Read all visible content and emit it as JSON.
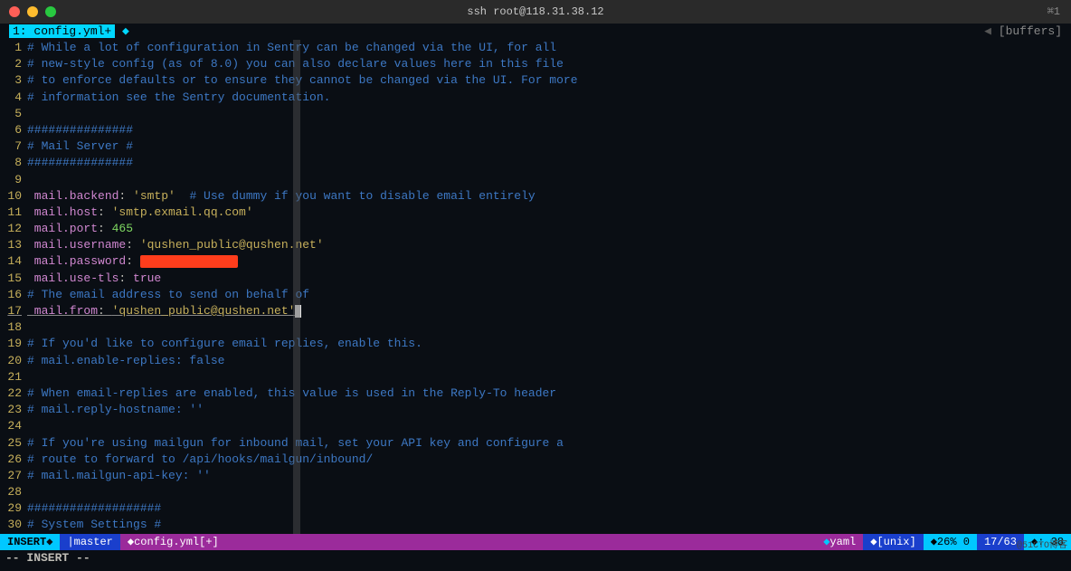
{
  "title": "ssh root@118.31.38.12",
  "title_keys": "⌘1",
  "buffer_tab": "1: config.yml+",
  "buffer_right": "[buffers]",
  "lines": [
    {
      "n": "1",
      "segs": [
        {
          "t": "# While a lot of configuration in Sentry can be changed via the UI, for all",
          "c": "comment"
        }
      ]
    },
    {
      "n": "2",
      "segs": [
        {
          "t": "# new-style config (as of 8.0) you can also declare values here in this file",
          "c": "comment"
        }
      ]
    },
    {
      "n": "3",
      "segs": [
        {
          "t": "# to enforce defaults or to ensure they cannot be changed via the UI. For more",
          "c": "comment"
        }
      ]
    },
    {
      "n": "4",
      "segs": [
        {
          "t": "# information see the Sentry documentation.",
          "c": "comment"
        }
      ]
    },
    {
      "n": "5",
      "segs": []
    },
    {
      "n": "6",
      "segs": [
        {
          "t": "###############",
          "c": "comment"
        }
      ]
    },
    {
      "n": "7",
      "segs": [
        {
          "t": "# Mail Server #",
          "c": "comment"
        }
      ]
    },
    {
      "n": "8",
      "segs": [
        {
          "t": "###############",
          "c": "comment"
        }
      ]
    },
    {
      "n": "9",
      "segs": []
    },
    {
      "n": "10",
      "segs": [
        {
          "t": " mail.backend",
          "c": "key"
        },
        {
          "t": ": ",
          "c": "colon"
        },
        {
          "t": "'smtp'",
          "c": "string"
        },
        {
          "t": "  # Use dummy if you want to disable email entirely",
          "c": "comment"
        }
      ]
    },
    {
      "n": "11",
      "segs": [
        {
          "t": " mail.host",
          "c": "key"
        },
        {
          "t": ": ",
          "c": "colon"
        },
        {
          "t": "'smtp.exmail.qq.com'",
          "c": "string"
        }
      ]
    },
    {
      "n": "12",
      "segs": [
        {
          "t": " mail.port",
          "c": "key"
        },
        {
          "t": ": ",
          "c": "colon"
        },
        {
          "t": "465",
          "c": "value"
        }
      ]
    },
    {
      "n": "13",
      "segs": [
        {
          "t": " mail.username",
          "c": "key"
        },
        {
          "t": ": ",
          "c": "colon"
        },
        {
          "t": "'qushen_public@qushen.net'",
          "c": "string"
        }
      ]
    },
    {
      "n": "14",
      "segs": [
        {
          "t": " mail.password",
          "c": "key"
        },
        {
          "t": ": ",
          "c": "colon"
        },
        {
          "t": "",
          "c": "redact"
        }
      ]
    },
    {
      "n": "15",
      "segs": [
        {
          "t": " mail.use-tls",
          "c": "key"
        },
        {
          "t": ": ",
          "c": "colon"
        },
        {
          "t": "true",
          "c": "bool"
        }
      ]
    },
    {
      "n": "16",
      "segs": [
        {
          "t": "# The email address to send on behalf of",
          "c": "comment"
        }
      ]
    },
    {
      "n": "17",
      "active": true,
      "segs": [
        {
          "t": " mail.from",
          "c": "key"
        },
        {
          "t": ": ",
          "c": "colon"
        },
        {
          "t": "'qushen_public@qushen.net'",
          "c": "string"
        },
        {
          "t": "",
          "c": "cursor"
        }
      ]
    },
    {
      "n": "18",
      "segs": []
    },
    {
      "n": "19",
      "segs": [
        {
          "t": "# If you'd like to configure email replies, enable this.",
          "c": "comment"
        }
      ]
    },
    {
      "n": "20",
      "segs": [
        {
          "t": "# mail.enable-replies: false",
          "c": "comment"
        }
      ]
    },
    {
      "n": "21",
      "segs": []
    },
    {
      "n": "22",
      "segs": [
        {
          "t": "# When email-replies are enabled, this value is used in the Reply-To header",
          "c": "comment"
        }
      ]
    },
    {
      "n": "23",
      "segs": [
        {
          "t": "# mail.reply-hostname: ''",
          "c": "comment"
        }
      ]
    },
    {
      "n": "24",
      "segs": []
    },
    {
      "n": "25",
      "segs": [
        {
          "t": "# If you're using mailgun for inbound mail, set your API key and configure a",
          "c": "comment"
        }
      ]
    },
    {
      "n": "26",
      "segs": [
        {
          "t": "# route to forward to /api/hooks/mailgun/inbound/",
          "c": "comment"
        }
      ]
    },
    {
      "n": "27",
      "segs": [
        {
          "t": "# mail.mailgun-api-key: ''",
          "c": "comment"
        }
      ]
    },
    {
      "n": "28",
      "segs": []
    },
    {
      "n": "29",
      "segs": [
        {
          "t": "###################",
          "c": "comment"
        }
      ]
    },
    {
      "n": "30",
      "segs": [
        {
          "t": "# System Settings #",
          "c": "comment"
        }
      ]
    }
  ],
  "status": {
    "mode": "INSERT",
    "branch": "master",
    "file": "config.yml[+]",
    "filetype": "yaml",
    "format": "[unix]",
    "percent": "26% 0",
    "position": "17/63",
    "col": ": 38"
  },
  "cmd": "-- INSERT --",
  "watermark": "@51CTO博客"
}
